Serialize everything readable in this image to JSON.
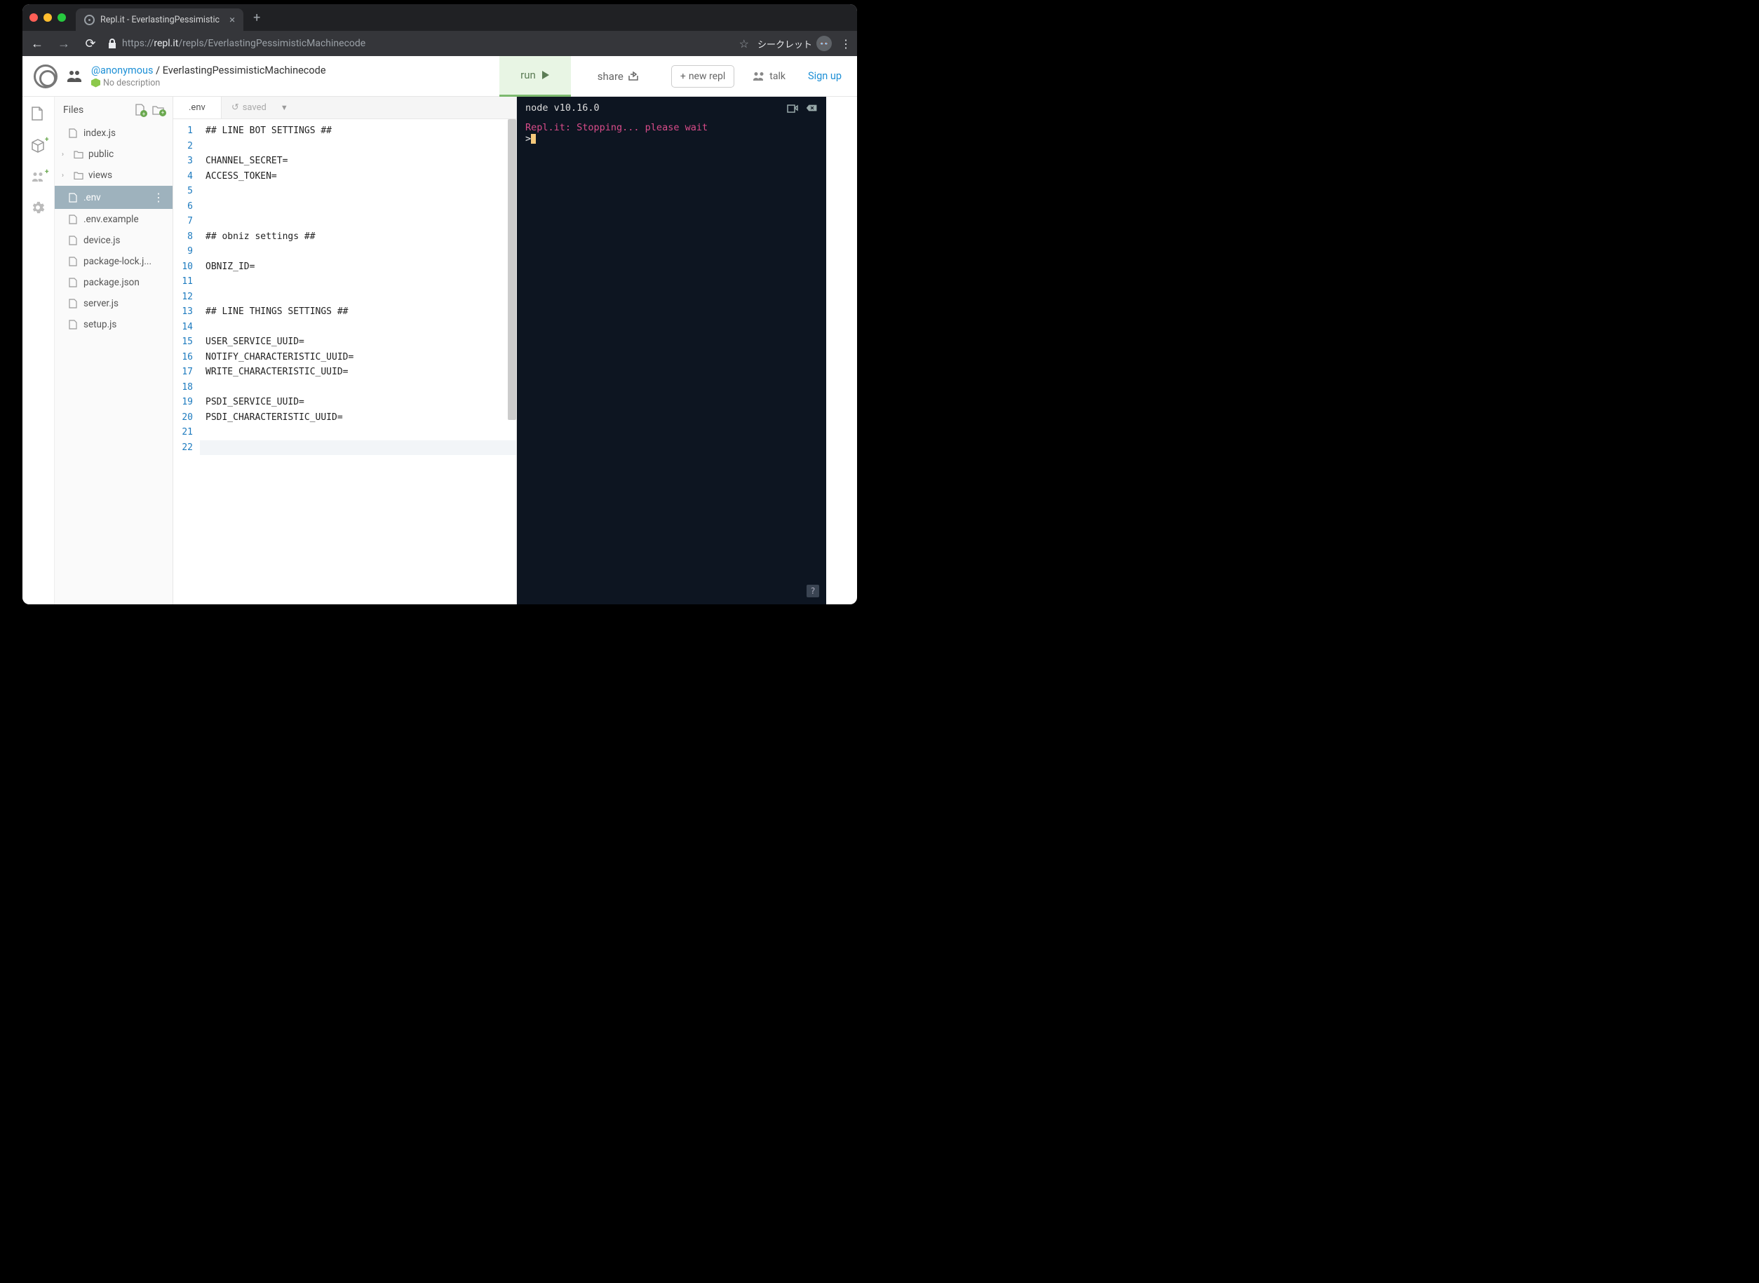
{
  "browser": {
    "tab_title": "Repl.it - EverlastingPessimistic",
    "url_display": "https://repl.it/repls/EverlastingPessimisticMachinecode",
    "url_host": "repl.it",
    "url_path": "/repls/EverlastingPessimisticMachinecode",
    "incognito_label": "シークレット"
  },
  "header": {
    "user": "@anonymous",
    "repl_name": "EverlastingPessimisticMachinecode",
    "description": "No description",
    "run_label": "run",
    "share_label": "share",
    "new_repl_label": "new repl",
    "talk_label": "talk",
    "signup_label": "Sign up"
  },
  "files": {
    "header": "Files",
    "items": [
      {
        "name": "index.js",
        "type": "file"
      },
      {
        "name": "public",
        "type": "folder"
      },
      {
        "name": "views",
        "type": "folder"
      },
      {
        "name": ".env",
        "type": "file",
        "selected": true
      },
      {
        "name": ".env.example",
        "type": "file"
      },
      {
        "name": "device.js",
        "type": "file"
      },
      {
        "name": "package-lock.j...",
        "type": "file"
      },
      {
        "name": "package.json",
        "type": "file"
      },
      {
        "name": "server.js",
        "type": "file"
      },
      {
        "name": "setup.js",
        "type": "file"
      }
    ]
  },
  "editor": {
    "tab_name": ".env",
    "saved_label": "saved",
    "lines": [
      "## LINE BOT SETTINGS ##",
      "",
      "CHANNEL_SECRET=",
      "ACCESS_TOKEN=",
      "",
      "",
      "",
      "## obniz settings ##",
      "",
      "OBNIZ_ID=",
      "",
      "",
      "## LINE THINGS SETTINGS ##",
      "",
      "USER_SERVICE_UUID=",
      "NOTIFY_CHARACTERISTIC_UUID=",
      "WRITE_CHARACTERISTIC_UUID=",
      "",
      "PSDI_SERVICE_UUID=",
      "PSDI_CHARACTERISTIC_UUID=",
      "",
      ""
    ]
  },
  "console": {
    "node_version": "node v10.16.0",
    "status": "Repl.it: Stopping... please wait",
    "prompt": ">"
  }
}
